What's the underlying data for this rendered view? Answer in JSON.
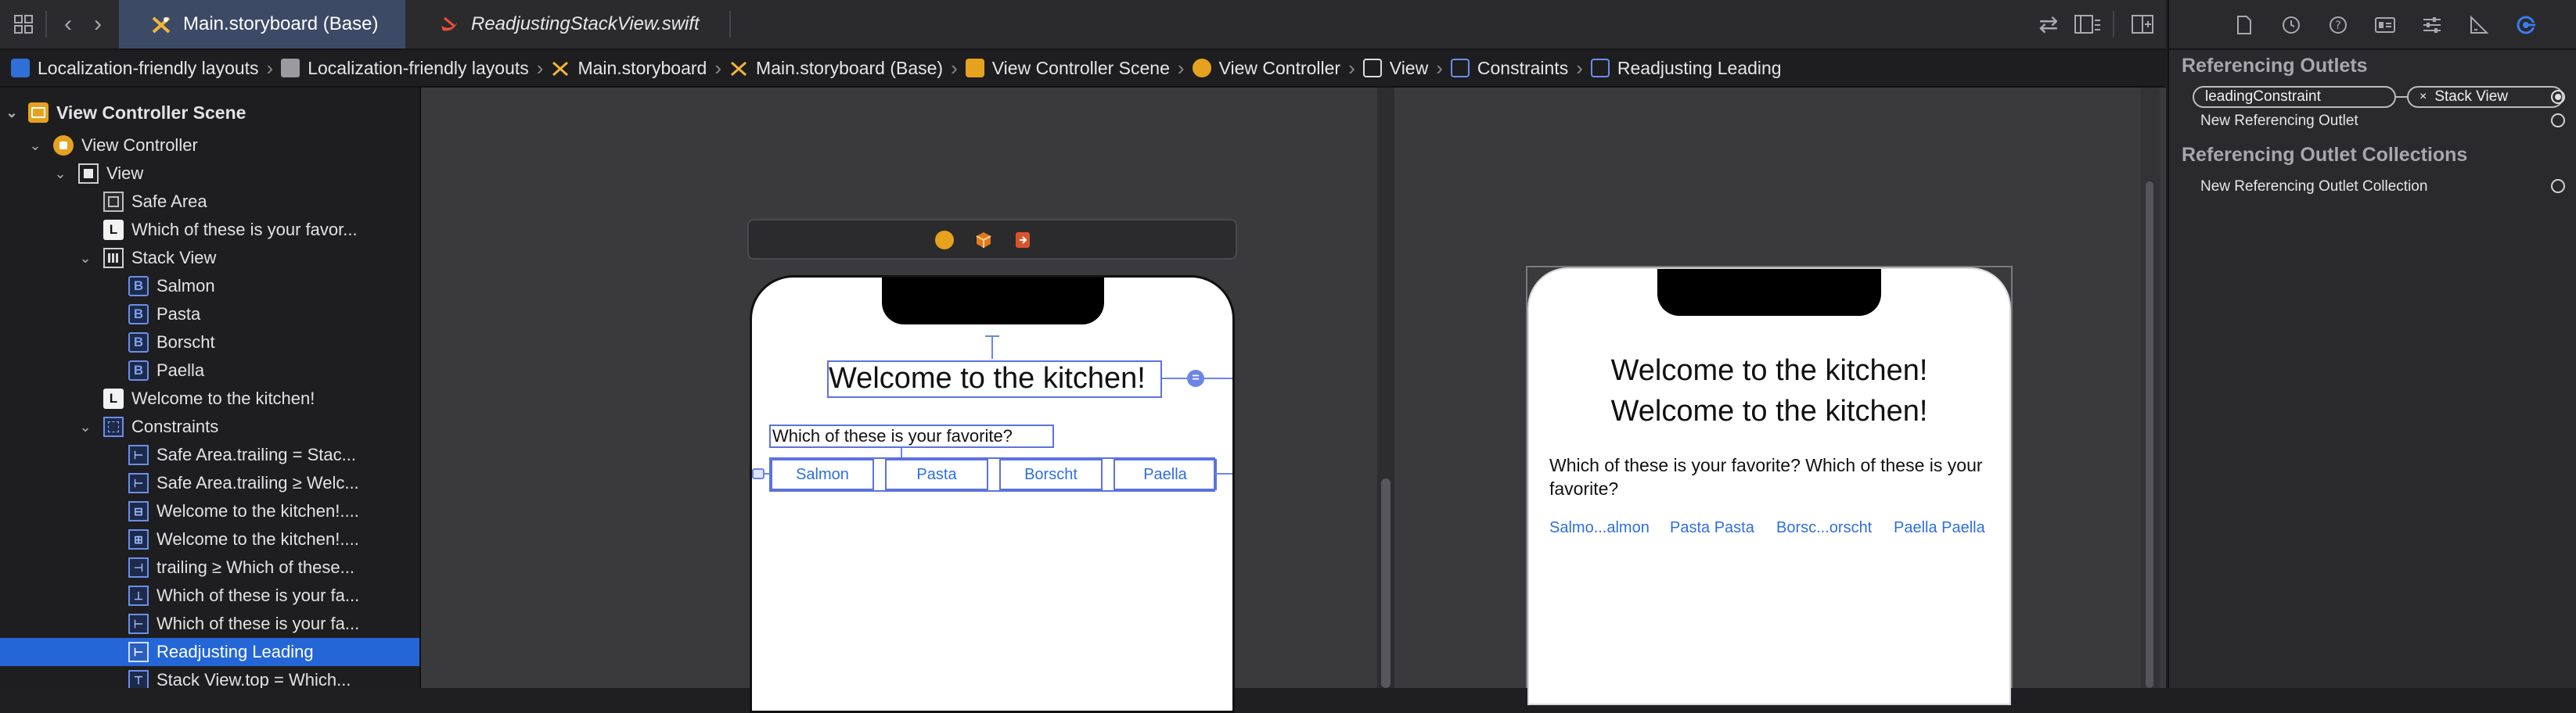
{
  "tabs": [
    {
      "label": "Main.storyboard (Base)",
      "active": true
    },
    {
      "label": "ReadjustingStackView.swift",
      "active": false
    }
  ],
  "breadcrumb": [
    "Localization-friendly layouts",
    "Localization-friendly layouts",
    "Main.storyboard",
    "Main.storyboard (Base)",
    "View Controller Scene",
    "View Controller",
    "View",
    "Constraints",
    "Readjusting Leading"
  ],
  "navigator": {
    "items": [
      {
        "label": "View Controller Scene",
        "icon": "scene-icon"
      },
      {
        "label": "View Controller",
        "icon": "view-controller-icon"
      },
      {
        "label": "View",
        "icon": "view-icon"
      },
      {
        "label": "Safe Area",
        "icon": "safe-area-icon"
      },
      {
        "label": "Which of these is your favor...",
        "icon": "label-icon"
      },
      {
        "label": "Stack View",
        "icon": "stack-view-icon"
      },
      {
        "label": "Salmon",
        "icon": "button-icon"
      },
      {
        "label": "Pasta",
        "icon": "button-icon"
      },
      {
        "label": "Borscht",
        "icon": "button-icon"
      },
      {
        "label": "Paella",
        "icon": "button-icon"
      },
      {
        "label": "Welcome to the kitchen!",
        "icon": "label-icon"
      },
      {
        "label": "Constraints",
        "icon": "constraints-icon"
      },
      {
        "label": "Safe Area.trailing = Stac...",
        "icon": "constraint-icon"
      },
      {
        "label": "Safe Area.trailing ≥ Welc...",
        "icon": "constraint-icon"
      },
      {
        "label": "Welcome to the kitchen!....",
        "icon": "constraint-icon"
      },
      {
        "label": "Welcome to the kitchen!....",
        "icon": "constraint-icon"
      },
      {
        "label": "trailing ≥ Which of these...",
        "icon": "constraint-icon"
      },
      {
        "label": "Which of these is your fa...",
        "icon": "constraint-icon"
      },
      {
        "label": "Which of these is your fa...",
        "icon": "constraint-icon"
      },
      {
        "label": "Readjusting Leading",
        "icon": "constraint-icon"
      },
      {
        "label": "Stack View.top = Which...",
        "icon": "constraint-icon"
      }
    ],
    "selected": "Readjusting Leading"
  },
  "canvas": {
    "editor": {
      "title": "Welcome to the kitchen!",
      "question": "Which of these is your favorite?",
      "buttons": [
        "Salmon",
        "Pasta",
        "Borscht",
        "Paella"
      ],
      "badge": "="
    },
    "preview": {
      "title_line1": "Welcome to the kitchen!",
      "title_line2": "Welcome to the kitchen!",
      "question": "Which of these is your favorite? Which of these is your favorite?",
      "buttons": [
        "Salmo...almon",
        "Pasta Pasta",
        "Borsc...orscht",
        "Paella Paella"
      ]
    }
  },
  "inspector": {
    "outlets_heading": "Referencing Outlets",
    "outlet_name": "leadingConstraint",
    "outlet_target": "Stack View",
    "outlet_remove": "×",
    "new_outlet": "New Referencing Outlet",
    "collections_heading": "Referencing Outlet Collections",
    "new_collection": "New Referencing Outlet Collection"
  },
  "colors": {
    "accent": "#2466d6",
    "selection": "#5b72e0",
    "link": "#2e6fe0",
    "scene_orange": "#e6a21e"
  }
}
